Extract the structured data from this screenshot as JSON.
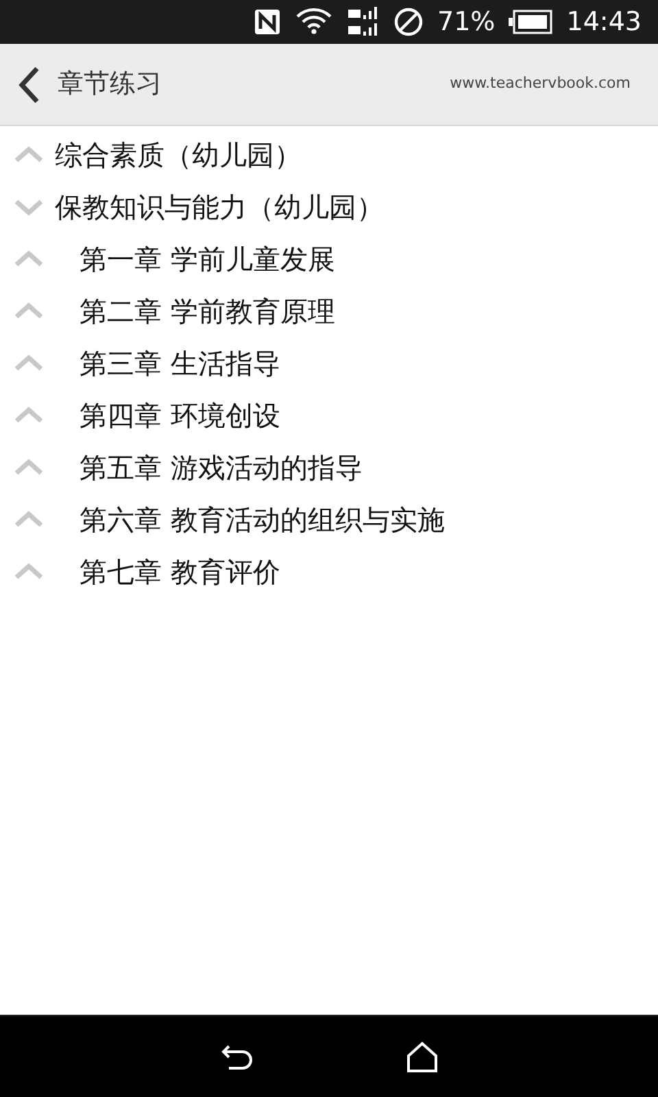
{
  "status_bar": {
    "battery": "71%",
    "time": "14:43"
  },
  "header": {
    "title": "章节练习",
    "site": "www.teachervbook.com"
  },
  "tree": [
    {
      "label": "综合素质（幼儿园）",
      "expanded": false
    },
    {
      "label": "保教知识与能力（幼儿园）",
      "expanded": true,
      "children": [
        {
          "label": "第一章 学前儿童发展",
          "expanded": false
        },
        {
          "label": "第二章 学前教育原理",
          "expanded": false
        },
        {
          "label": "第三章 生活指导",
          "expanded": false
        },
        {
          "label": "第四章 环境创设",
          "expanded": false
        },
        {
          "label": "第五章 游戏活动的指导",
          "expanded": false
        },
        {
          "label": "第六章 教育活动的组织与实施",
          "expanded": false
        },
        {
          "label": "第七章 教育评价",
          "expanded": false
        }
      ]
    }
  ]
}
